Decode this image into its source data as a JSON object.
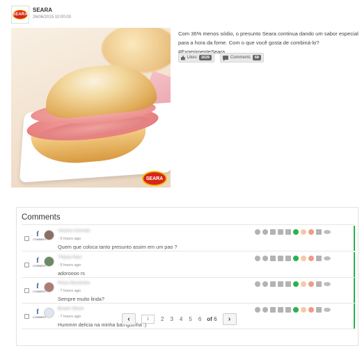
{
  "post": {
    "brand_name": "SEARA",
    "brand_logo_text": "SEARA",
    "date": "26/06/2015 10:00:00",
    "image_logo_text": "SEARA",
    "caption": "Com 36% menos sódio, o presunto Seara continua dando um sabor especial para a hora da fome. Com o que você gosta de combiná-lo? #ExperimenteSeara",
    "likes_label": "Likes",
    "likes_count": "1629",
    "comments_label": "Comments",
    "comments_count": "68"
  },
  "comments_panel": {
    "title": "Comments",
    "source_letter": "f",
    "source_label": "COMMENT",
    "comments": [
      {
        "name": "Victória Schmitz",
        "time": "· 5 hours ago",
        "text": "Quem que coloca tanto presunto assim em um pao ?",
        "avatar_color": "#8a6f63"
      },
      {
        "name": "Thiane Reis",
        "time": "· 5 hours ago",
        "text": "adoroooo rs",
        "avatar_color": "#6b8a5e"
      },
      {
        "name": "Rosa Alexandra",
        "time": "· 7 hours ago",
        "text": "Sempre muito linda?",
        "avatar_color": "#b07a70"
      },
      {
        "name": "Brown Stone",
        "time": "· 7 hours ago",
        "text": "Hummm delicia na minha barriguinha :)",
        "avatar_color": "#dfe6ee"
      }
    ]
  },
  "pagination": {
    "prev": "‹",
    "next": "›",
    "current": "1",
    "pages": [
      "2",
      "3",
      "4",
      "5",
      "6"
    ],
    "of_label": "of",
    "total": "6"
  },
  "colors": {
    "brand_red": "#d8261d",
    "brand_yellow": "#f3c000",
    "facebook_blue": "#3b5998",
    "status_green": "#25b34b"
  }
}
